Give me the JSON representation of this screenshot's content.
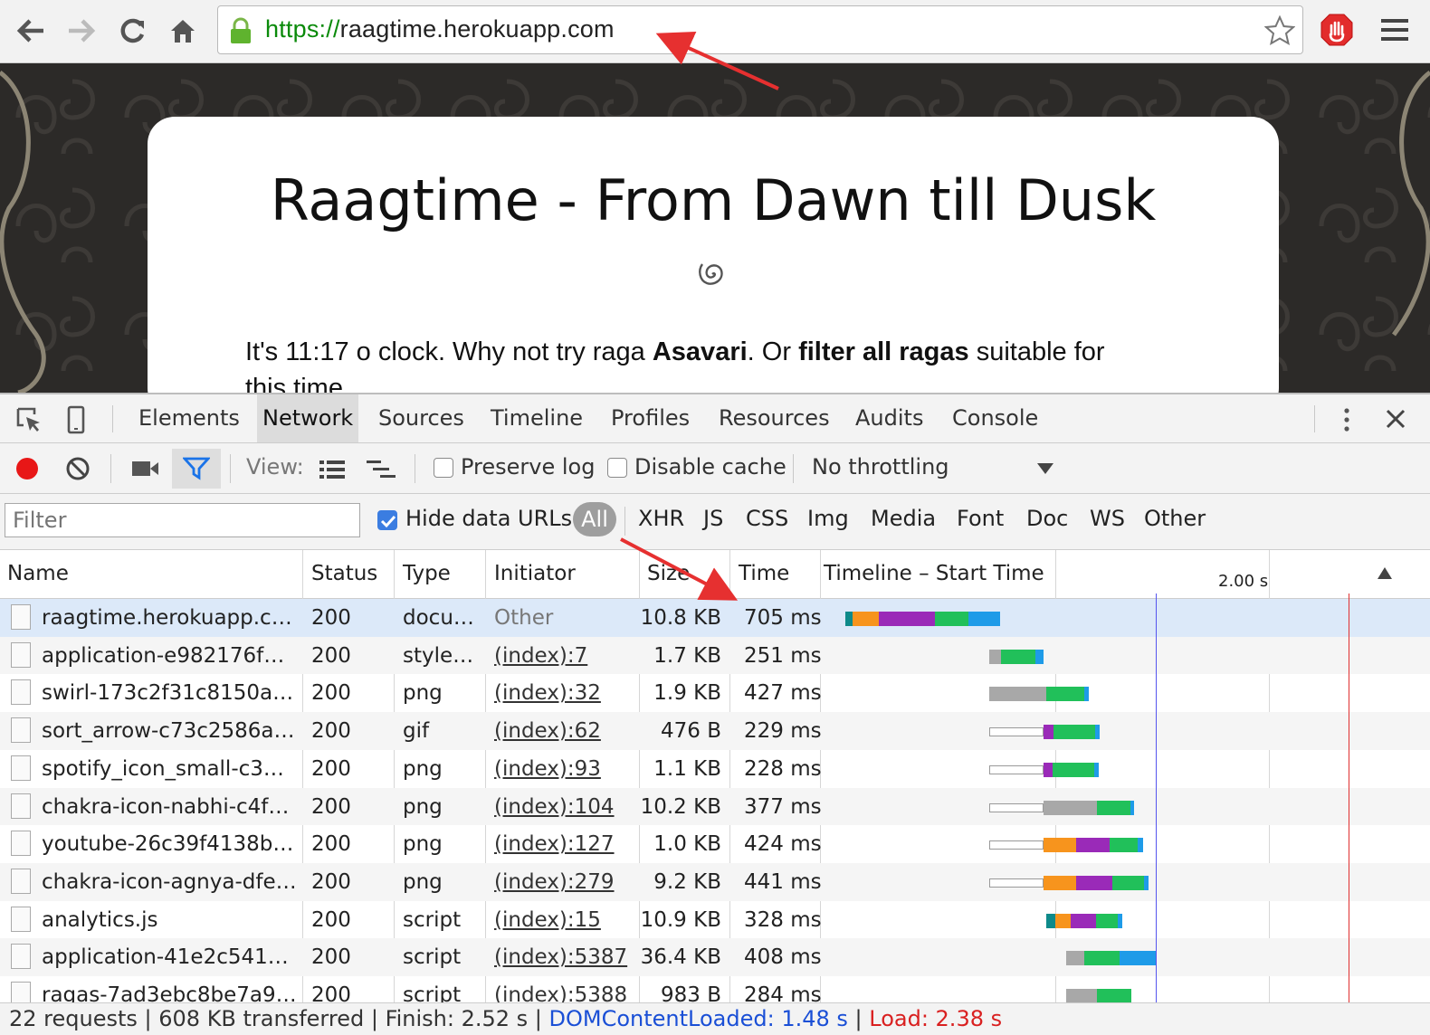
{
  "browser": {
    "url_scheme": "https://",
    "url_host": "raagtime.herokuapp.com"
  },
  "page": {
    "title": "Raagtime - From Dawn till Dusk",
    "intro_prefix": "It's 11:17 o clock. Why not try raga ",
    "raga": "Asavari",
    "intro_mid": ". Or ",
    "filter_link": "filter all ragas",
    "intro_suffix": " suitable for",
    "intro_line2": "this time"
  },
  "devtools": {
    "tabs": [
      "Elements",
      "Network",
      "Sources",
      "Timeline",
      "Profiles",
      "Resources",
      "Audits",
      "Console"
    ],
    "active_tab": "Network",
    "toolbar": {
      "view_label": "View:",
      "preserve_log": "Preserve log",
      "disable_cache": "Disable cache",
      "throttling": "No throttling"
    },
    "filterbar": {
      "filter_placeholder": "Filter",
      "hide_data_urls": "Hide data URLs",
      "types": [
        "All",
        "XHR",
        "JS",
        "CSS",
        "Img",
        "Media",
        "Font",
        "Doc",
        "WS",
        "Other"
      ]
    },
    "columns": {
      "name": "Name",
      "status": "Status",
      "type": "Type",
      "initiator": "Initiator",
      "size": "Size",
      "time": "Time",
      "timeline": "Timeline – Start Time",
      "tick": "2.00 s"
    },
    "rows": [
      {
        "name": "raagtime.herokuapp.com",
        "status": "200",
        "type": "docu…",
        "initiator": "Other",
        "size": "10.8 KB",
        "time": "705 ms"
      },
      {
        "name": "application-e982176f8…",
        "status": "200",
        "type": "styles…",
        "initiator": "(index):7",
        "size": "1.7 KB",
        "time": "251 ms"
      },
      {
        "name": "swirl-173c2f31c8150a2…",
        "status": "200",
        "type": "png",
        "initiator": "(index):32",
        "size": "1.9 KB",
        "time": "427 ms"
      },
      {
        "name": "sort_arrow-c73c2586ad…",
        "status": "200",
        "type": "gif",
        "initiator": "(index):62",
        "size": "476 B",
        "time": "229 ms"
      },
      {
        "name": "spotify_icon_small-c3d…",
        "status": "200",
        "type": "png",
        "initiator": "(index):93",
        "size": "1.1 KB",
        "time": "228 ms"
      },
      {
        "name": "chakra-icon-nabhi-c4f…",
        "status": "200",
        "type": "png",
        "initiator": "(index):104",
        "size": "10.2 KB",
        "time": "377 ms"
      },
      {
        "name": "youtube-26c39f4138b0…",
        "status": "200",
        "type": "png",
        "initiator": "(index):127",
        "size": "1.0 KB",
        "time": "424 ms"
      },
      {
        "name": "chakra-icon-agnya-dfe…",
        "status": "200",
        "type": "png",
        "initiator": "(index):279",
        "size": "9.2 KB",
        "time": "441 ms"
      },
      {
        "name": "analytics.js",
        "status": "200",
        "type": "script",
        "initiator": "(index):15",
        "size": "10.9 KB",
        "time": "328 ms"
      },
      {
        "name": "application-41e2c5416…",
        "status": "200",
        "type": "script",
        "initiator": "(index):5387",
        "size": "36.4 KB",
        "time": "408 ms"
      },
      {
        "name": "ragas-7ad3ebc8be7a96…",
        "status": "200",
        "type": "script",
        "initiator": "(index):5388",
        "size": "983 B",
        "time": "284 ms"
      }
    ],
    "summary": {
      "requests": "22 requests",
      "transferred": "608 KB transferred",
      "finish": "Finish: 2.52 s",
      "dom_content_loaded": "DOMContentLoaded: 1.48 s",
      "load": "Load: 2.38 s"
    }
  },
  "colors": {
    "dns": "#0e8a8a",
    "connect": "#f7941d",
    "ssl": "#9a2ab8",
    "waiting": "#21c05a",
    "receiving": "#1e9be8",
    "queued": "#a8a8a8",
    "dcl_line": "#5555ee",
    "load_line": "#e03030"
  }
}
